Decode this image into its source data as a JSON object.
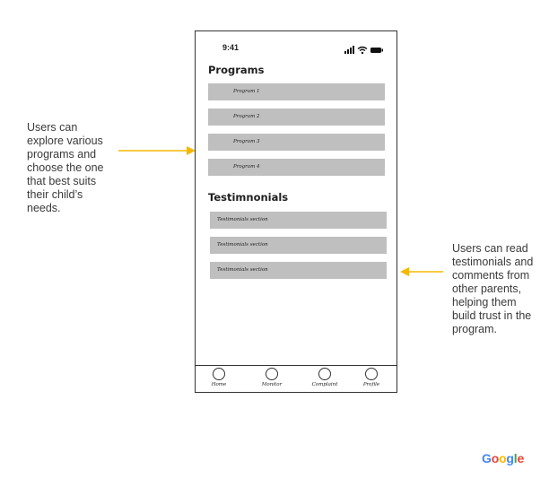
{
  "annotations": {
    "left": "Users can explore various programs and choose the one that best suits their child’s needs.",
    "right": "Users can read testimonials and comments from other parents, helping them build trust in the program.",
    "arrow_color": "#f5b800"
  },
  "status_bar": {
    "time": "9:41",
    "icons": [
      "signal-icon",
      "wifi-icon",
      "battery-icon"
    ]
  },
  "programs": {
    "title": "Programs",
    "items": [
      "Program 1",
      "Program 2",
      "Program 3",
      "Program 4"
    ]
  },
  "testimonials": {
    "title": "Testimnonials",
    "items": [
      "Testimonials section",
      "Testimonials section",
      "Testimonials section"
    ]
  },
  "tabbar": {
    "items": [
      "Home",
      "Monitor",
      "Complaint",
      "Profile"
    ]
  },
  "logo": {
    "text": "Google",
    "letter_colors": [
      "#4285F4",
      "#EA4335",
      "#FBBC05",
      "#4285F4",
      "#34A853",
      "#EA4335"
    ]
  }
}
